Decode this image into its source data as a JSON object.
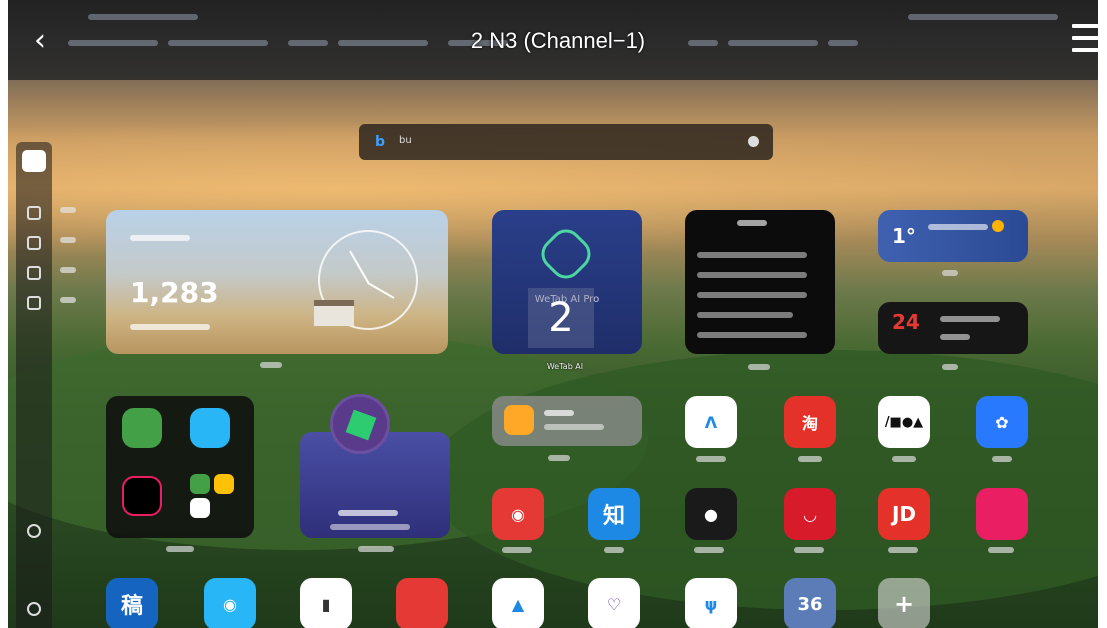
{
  "window": {
    "title": "2 N3 (Channel−1)"
  },
  "icons": {
    "back": "back-arrow-icon",
    "menu": "hamburger-menu-icon"
  },
  "search": {
    "placeholder": "bu"
  },
  "widgets": {
    "stats": {
      "value": "1,283"
    },
    "ai": {
      "name": "WeTab AI Pro",
      "overlay": "2",
      "label": "WeTab AI"
    },
    "weather": {
      "temp": "1°"
    },
    "calendar": {
      "day": "24"
    },
    "app_store": {
      "overlay_number": "36"
    }
  },
  "colors": {
    "accent": "#3aa0ff",
    "taobao": "#e4322b",
    "jd": "#e4322b",
    "zhihu": "#1e88e5"
  }
}
